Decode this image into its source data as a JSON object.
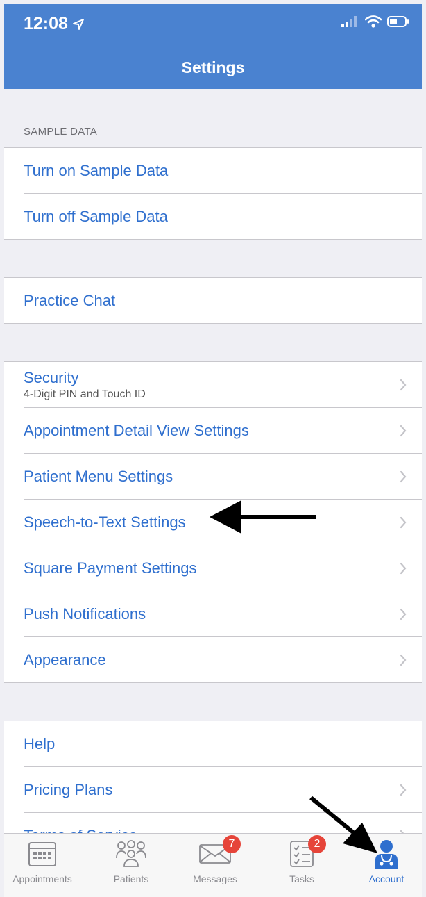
{
  "status_bar": {
    "time": "12:08"
  },
  "header": {
    "title": "Settings"
  },
  "sample_data_section": {
    "header": "SAMPLE DATA",
    "items": [
      {
        "label": "Turn on Sample Data"
      },
      {
        "label": "Turn off Sample Data"
      }
    ]
  },
  "chat_section": {
    "items": [
      {
        "label": "Practice Chat"
      }
    ]
  },
  "settings_section": {
    "security": {
      "label": "Security",
      "subtitle": "4-Digit PIN and Touch ID"
    },
    "items": [
      {
        "label": "Appointment Detail View Settings"
      },
      {
        "label": "Patient Menu Settings"
      },
      {
        "label": "Speech-to-Text Settings"
      },
      {
        "label": "Square Payment Settings"
      },
      {
        "label": "Push Notifications"
      },
      {
        "label": "Appearance"
      }
    ]
  },
  "help_section": {
    "items": [
      {
        "label": "Help"
      },
      {
        "label": "Pricing Plans"
      },
      {
        "label": "Terms of Service"
      }
    ]
  },
  "tab_bar": {
    "tabs": [
      {
        "label": "Appointments",
        "icon": "calendar-icon"
      },
      {
        "label": "Patients",
        "icon": "people-icon"
      },
      {
        "label": "Messages",
        "icon": "envelope-icon",
        "badge": "7"
      },
      {
        "label": "Tasks",
        "icon": "checklist-icon",
        "badge": "2"
      },
      {
        "label": "Account",
        "icon": "doctor-icon",
        "active": true
      }
    ]
  },
  "colors": {
    "accent": "#2f6fce",
    "header": "#4a82d0",
    "badge": "#e6453a"
  }
}
